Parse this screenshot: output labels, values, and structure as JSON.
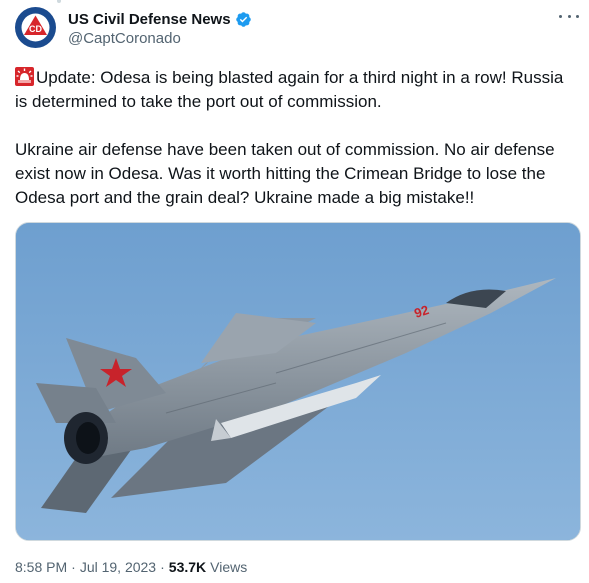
{
  "author": {
    "display_name": "US Civil Defense News",
    "handle": "@CaptCoronado",
    "verified": true,
    "avatar_text": "CD"
  },
  "tweet": {
    "paragraph1": "Update: Odesa is being blasted again for a third night in a row! Russia is determined to take the port out of commission.",
    "paragraph2": "Ukraine air defense have been taken out of commission. No air defense exist now in Odesa. Was it worth hitting the Crimean Bridge to lose the Odesa port and the grain deal? Ukraine made a big mistake!!",
    "leading_icon": "siren-icon"
  },
  "media": {
    "description_icon": "fighter-jet-image",
    "tail_number": "92"
  },
  "meta": {
    "time": "8:58 PM",
    "sep1": "·",
    "date": "Jul 19, 2023",
    "sep2": "·",
    "views_count": "53.7K",
    "views_label": "Views"
  },
  "colors": {
    "accent": "#1d9bf0",
    "secondary_text": "#536471",
    "avatar_bg": "#1b4b8f",
    "sky": "#7aa6d1"
  }
}
